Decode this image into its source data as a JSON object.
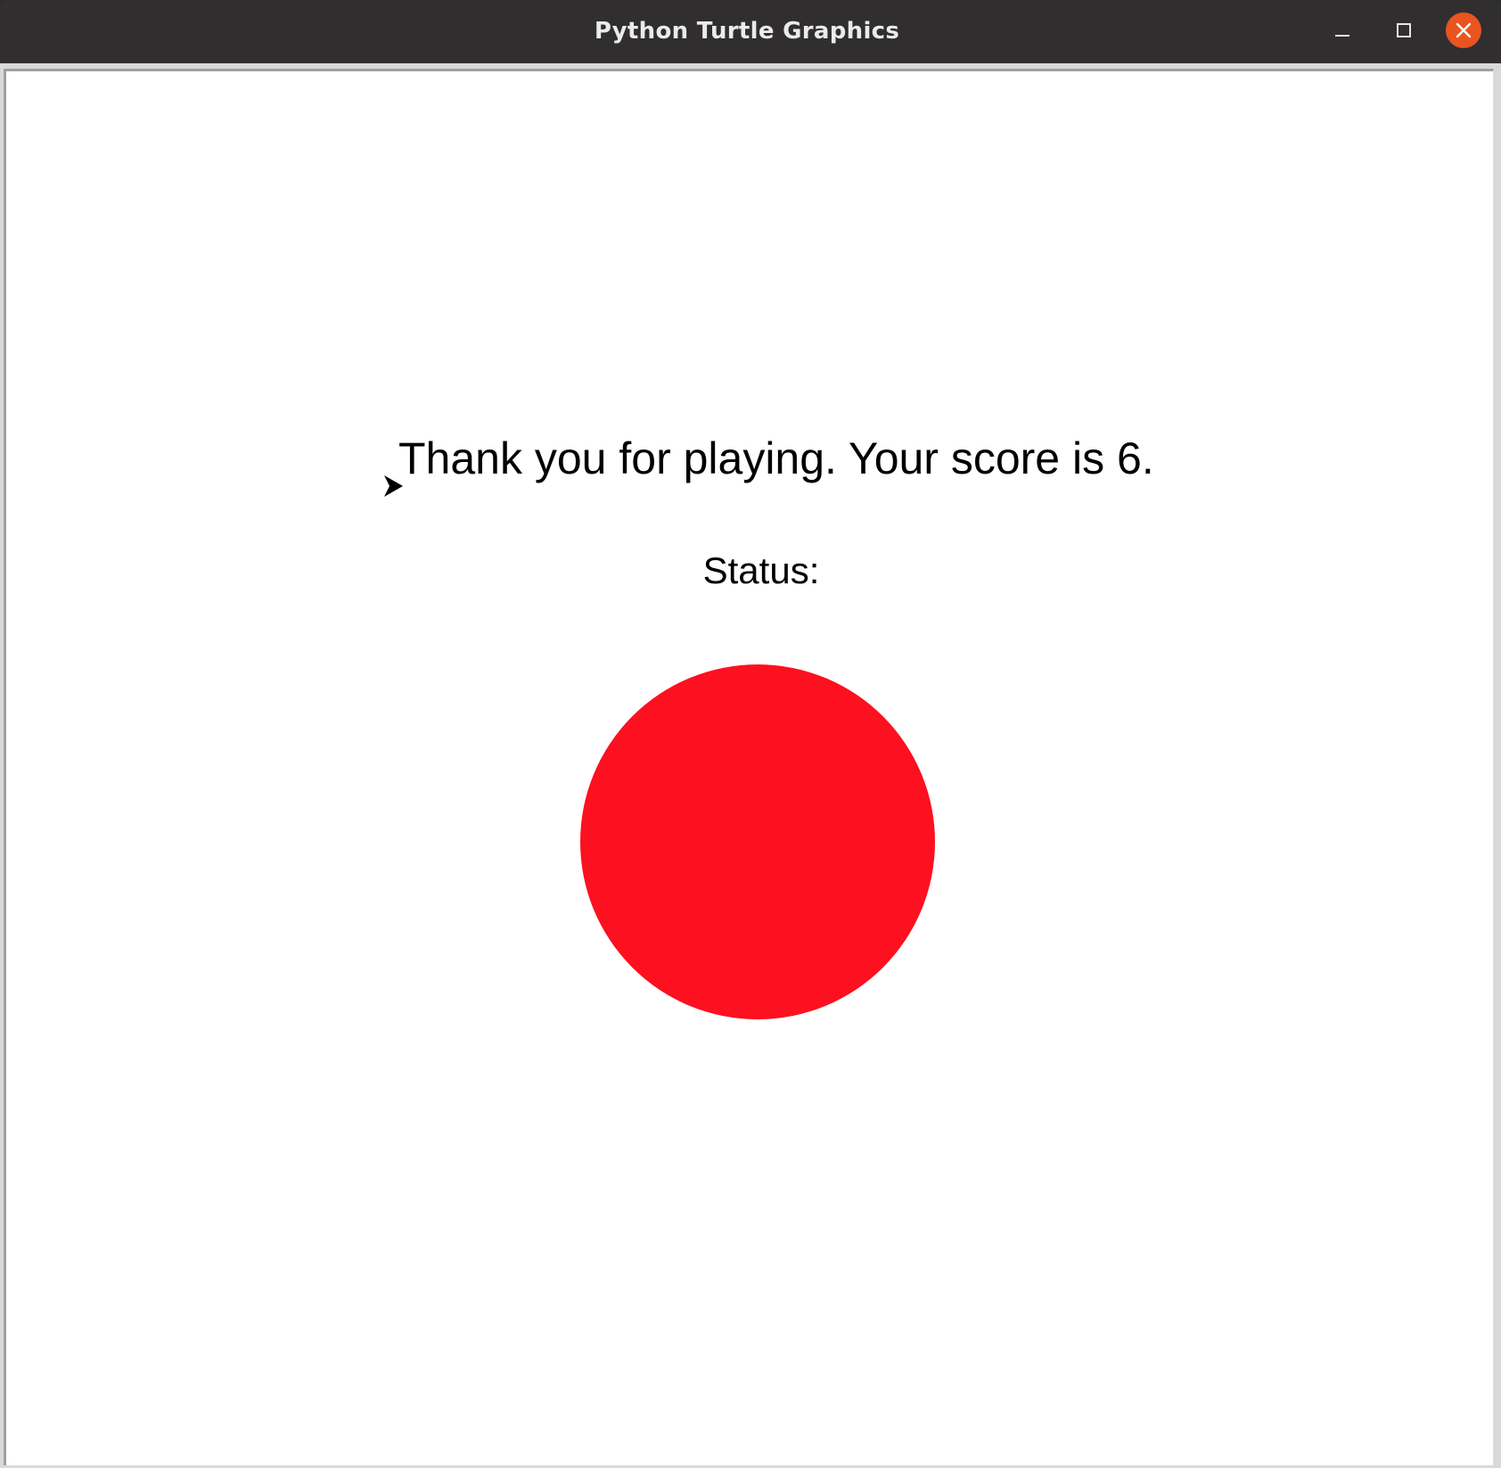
{
  "window": {
    "title": "Python Turtle Graphics"
  },
  "canvas": {
    "message": "Thank you for playing. Your score is 6.",
    "status_label": "Status:",
    "status_light_color": "#fd101f",
    "turtle_icon": "turtle-arrow-icon",
    "background_color": "#ffffff"
  },
  "titlebar_icons": {
    "minimize": "minimize-icon",
    "maximize": "maximize-icon",
    "close": "close-icon",
    "close_color": "#e95420"
  }
}
